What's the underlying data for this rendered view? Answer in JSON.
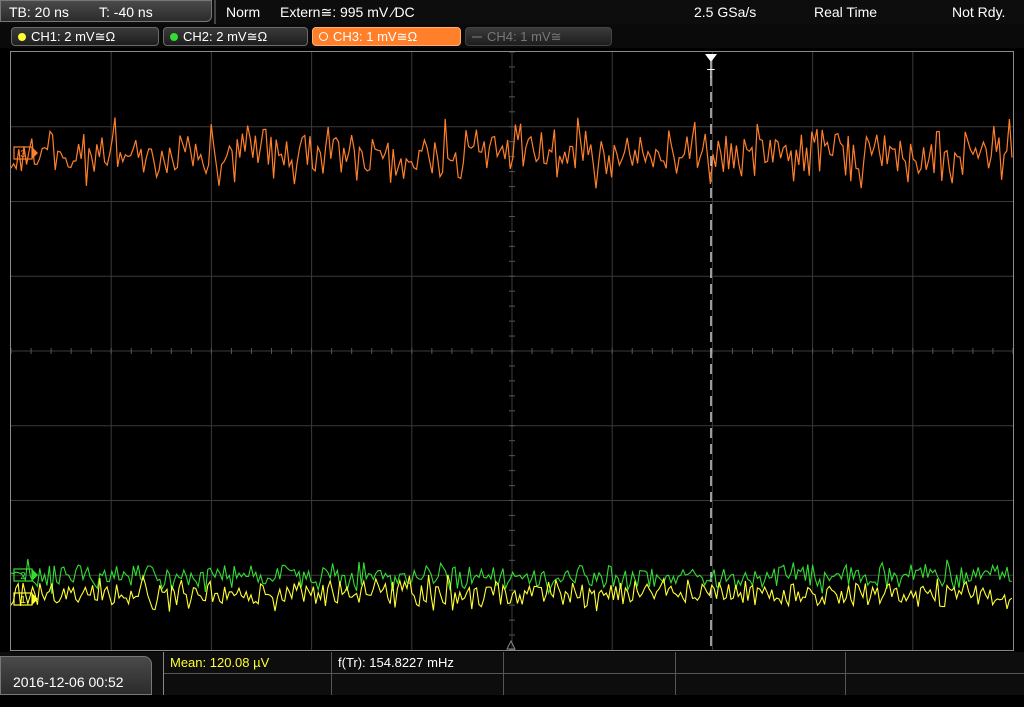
{
  "timebase": {
    "tb_label": "TB: 20 ns",
    "t_label": "T: -40 ns"
  },
  "status": {
    "mode": "Norm",
    "trigger": "Extern≅: 995 mV ∕DC",
    "sample_rate": "2.5 GSa/s",
    "acq_mode": "Real Time",
    "run_state": "Not Rdy."
  },
  "channels": [
    {
      "label": "CH1: 2 mV≅Ω",
      "color": "#ffff33"
    },
    {
      "label": "CH2: 2 mV≅Ω",
      "color": "#33dd33"
    },
    {
      "label": "CH3: 1 mV≅Ω",
      "color": "#ff7f2a"
    },
    {
      "label": "CH4: 1 mV≅",
      "color": "#666666"
    }
  ],
  "trigger_marker": {
    "label": "T"
  },
  "ground_markers": {
    "ch3": "3",
    "ch2": "2",
    "ch1": "1"
  },
  "date": "2016-12-06 00:52",
  "measurements": {
    "mean": "Mean: 120.08 µV",
    "freq": "f(Tr): 154.8227 mHz"
  }
}
